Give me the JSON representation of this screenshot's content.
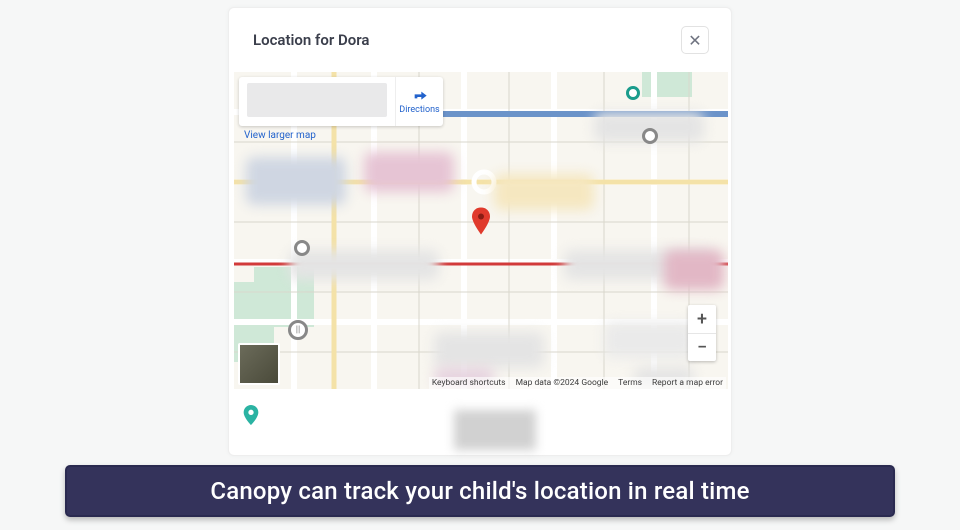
{
  "header": {
    "title": "Location for Dora",
    "close": "✕"
  },
  "map": {
    "directions_label": "Directions",
    "view_larger": "View larger map",
    "attribution": {
      "keyboard": "Keyboard shortcuts",
      "mapdata": "Map data ©2024 Google",
      "terms": "Terms",
      "report": "Report a map error"
    },
    "zoom": {
      "in": "+",
      "out": "−"
    }
  },
  "caption": "Canopy can track your child's location in real time"
}
